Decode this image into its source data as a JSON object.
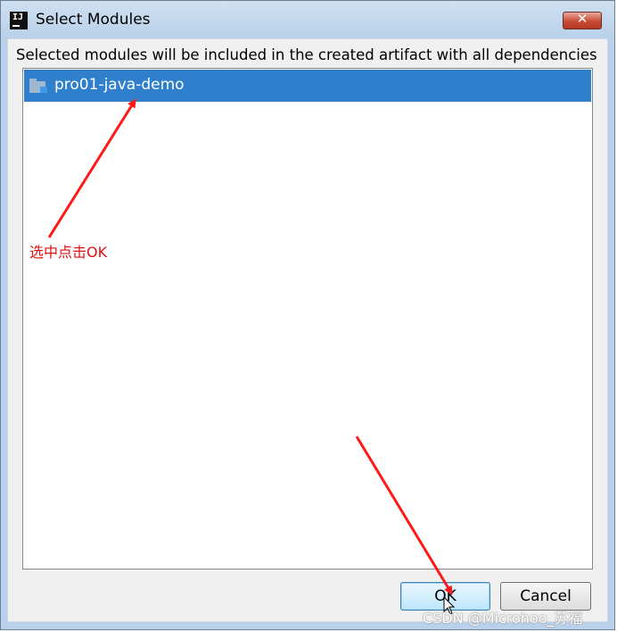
{
  "window": {
    "title": "Select Modules",
    "close_label": "✕"
  },
  "main": {
    "instruction": "Selected modules will be included in the created artifact with all dependencies",
    "modules": [
      {
        "label": "pro01-java-demo",
        "selected": true,
        "icon": "module-folder-icon"
      }
    ]
  },
  "annotation": {
    "text": "选中点击OK",
    "color": "#e01010"
  },
  "buttons": {
    "ok_label": "OK",
    "cancel_label": "Cancel"
  },
  "watermark": "CSDN @Microhoo_苏福",
  "colors": {
    "selection": "#2f7fcd",
    "arrow": "#ff1a1a"
  }
}
